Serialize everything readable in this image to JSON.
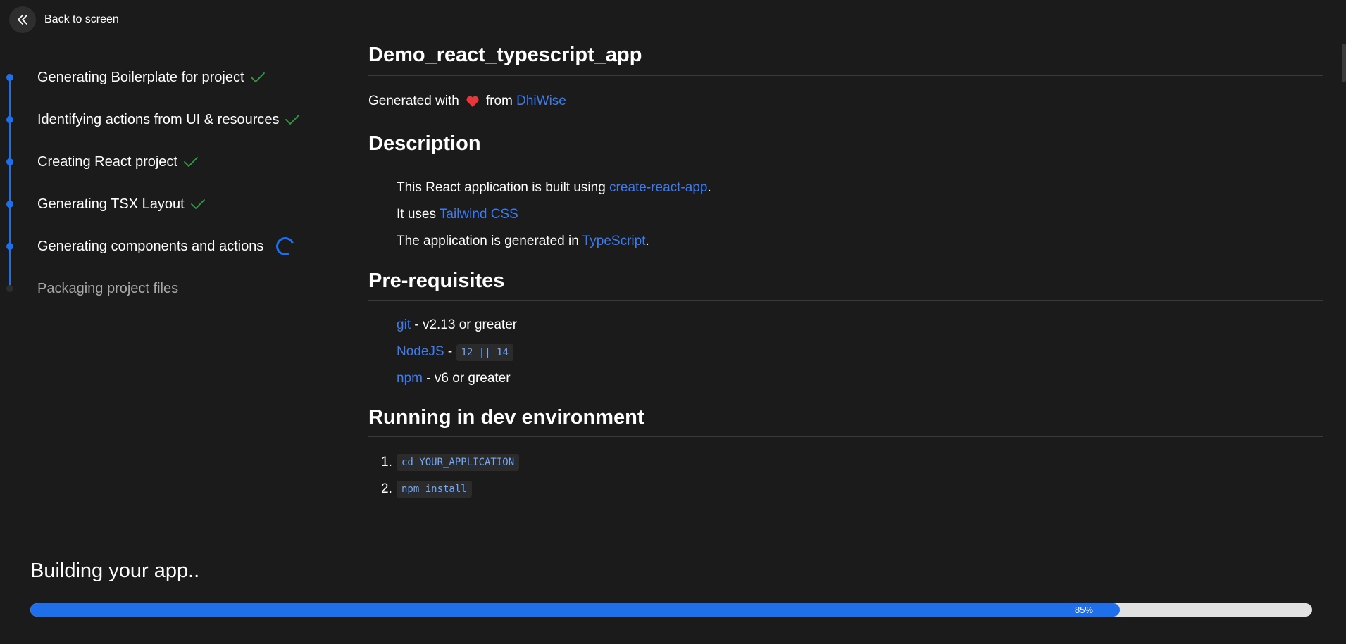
{
  "back": {
    "label": "Back to screen"
  },
  "steps": [
    {
      "label": "Generating Boilerplate for project",
      "status": "done"
    },
    {
      "label": "Identifying actions from UI & resources",
      "status": "done"
    },
    {
      "label": "Creating React project",
      "status": "done"
    },
    {
      "label": "Generating TSX Layout",
      "status": "done"
    },
    {
      "label": "Generating components and actions",
      "status": "in-progress"
    },
    {
      "label": "Packaging project files",
      "status": "pending"
    }
  ],
  "readme": {
    "title": "Demo_react_typescript_app",
    "generated": {
      "prefix": "Generated with",
      "middle": "from",
      "link": "DhiWise"
    },
    "description": {
      "heading": "Description",
      "line1": {
        "text": "This React application is built using ",
        "link": "create-react-app",
        "suffix": "."
      },
      "line2": {
        "text": "It uses ",
        "link": "Tailwind CSS"
      },
      "line3": {
        "text": "The application is generated in ",
        "link": "TypeScript",
        "suffix": "."
      }
    },
    "prereq": {
      "heading": "Pre-requisites",
      "git": {
        "link": "git",
        "text": " - v2.13 or greater"
      },
      "node": {
        "link": "NodeJS",
        "text": " - ",
        "code": "12 || 14"
      },
      "npm": {
        "link": "npm",
        "text": " - v6 or greater"
      }
    },
    "dev": {
      "heading": "Running in dev environment",
      "steps": [
        {
          "num": "1.",
          "code": "cd YOUR_APPLICATION"
        },
        {
          "num": "2.",
          "code": "npm install"
        }
      ]
    }
  },
  "build": {
    "title": "Building your app..",
    "progress": 85,
    "progress_label": "85%"
  },
  "colors": {
    "accent": "#1f6feb",
    "link": "#3d7bf2",
    "check": "#2ea043",
    "heart": "#e5383b",
    "background": "#1b1b1b"
  }
}
